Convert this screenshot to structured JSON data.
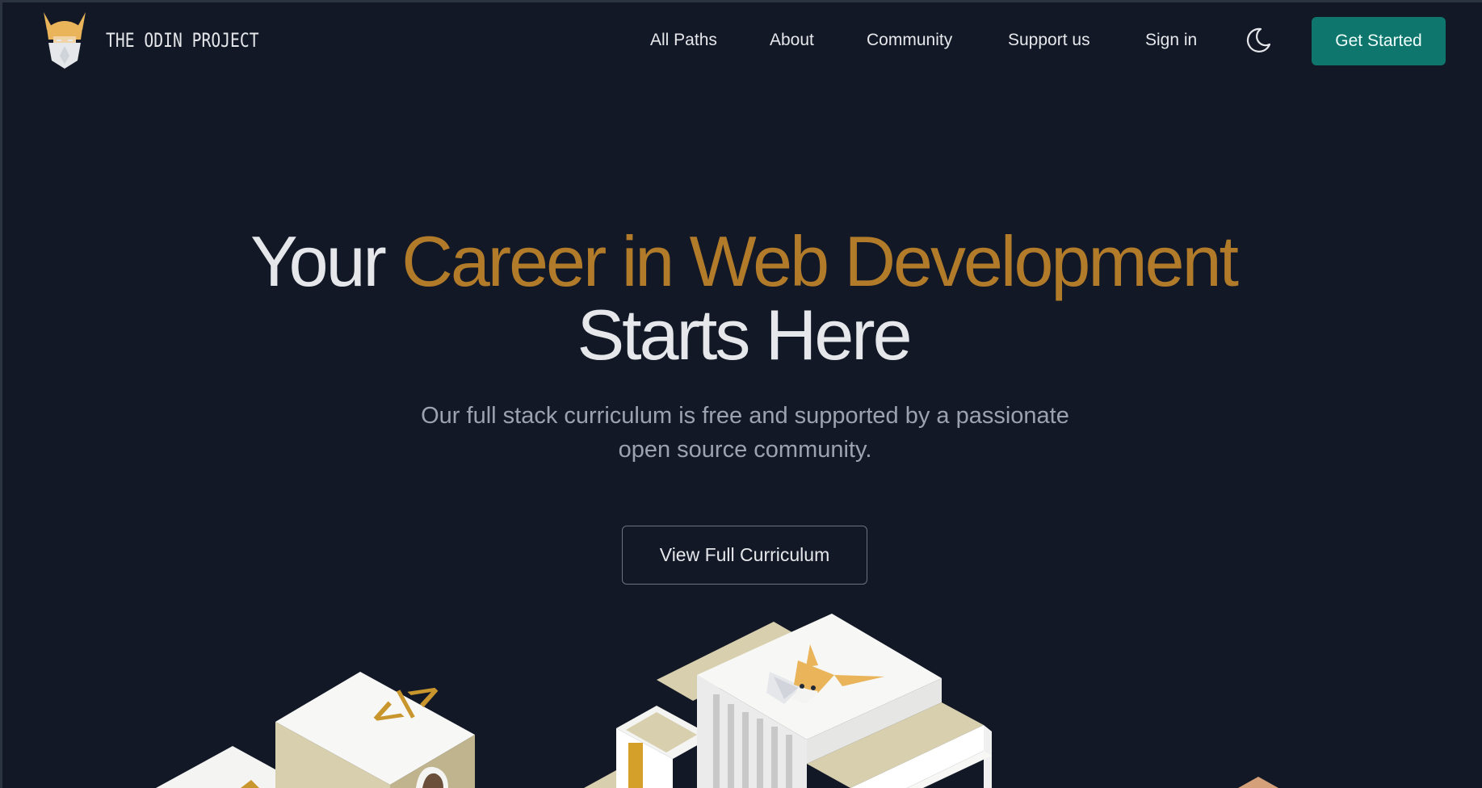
{
  "header": {
    "logo_text": "THE ODIN PROJECT",
    "nav": [
      {
        "label": "All Paths"
      },
      {
        "label": "About"
      },
      {
        "label": "Community"
      },
      {
        "label": "Support us"
      },
      {
        "label": "Sign in"
      }
    ],
    "theme_toggle_icon": "moon-icon",
    "cta_label": "Get Started"
  },
  "hero": {
    "title_lead": "Your ",
    "title_accent": "Career in Web Development",
    "title_tail": "Starts Here",
    "subtitle": "Our full stack curriculum is free and supported by a passionate open source community.",
    "button_label": "View Full Curriculum"
  },
  "illustration": {
    "code_symbol": "</>"
  },
  "colors": {
    "background": "#121826",
    "accent_gold": "#b27b2a",
    "cta_teal": "#0f766e",
    "text_light": "#e5e7eb",
    "text_muted": "#9ca3af"
  }
}
